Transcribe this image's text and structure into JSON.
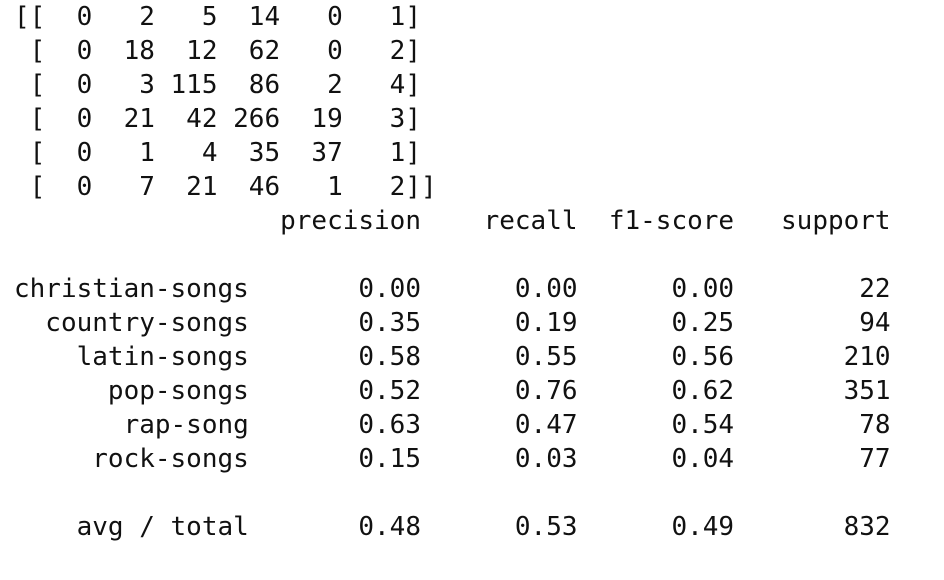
{
  "confusion_matrix_lines": [
    "[[  0   2   5  14   0   1]",
    " [  0  18  12  62   0   2]",
    " [  0   3 115  86   2   4]",
    " [  0  21  42 266  19   3]",
    " [  0   1   4  35  37   1]",
    " [  0   7  21  46   1   2]]"
  ],
  "report": {
    "header": "                 precision    recall  f1-score   support",
    "rows": [
      "christian-songs       0.00      0.00      0.00        22",
      "  country-songs       0.35      0.19      0.25        94",
      "    latin-songs       0.58      0.55      0.56       210",
      "      pop-songs       0.52      0.76      0.62       351",
      "       rap-song       0.63      0.47      0.54        78",
      "     rock-songs       0.15      0.03      0.04        77"
    ],
    "total": "    avg / total       0.48      0.53      0.49       832"
  }
}
